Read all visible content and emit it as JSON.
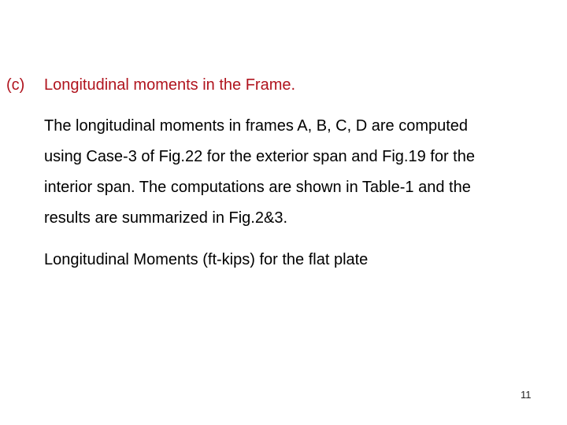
{
  "heading": {
    "label": "(c)",
    "title": "Longitudinal moments in the Frame.",
    "color": "#b0141e"
  },
  "paragraph": {
    "lines": [
      "The longitudinal moments in frames A, B, C, D are computed",
      "using Case-3 of Fig.22 for the exterior span and Fig.19 for the",
      "interior span. The computations are shown in Table-1 and the",
      "results are summarized in Fig.2&3."
    ]
  },
  "subtitle": "Longitudinal Moments (ft-kips) for the flat plate",
  "page_number": "11"
}
